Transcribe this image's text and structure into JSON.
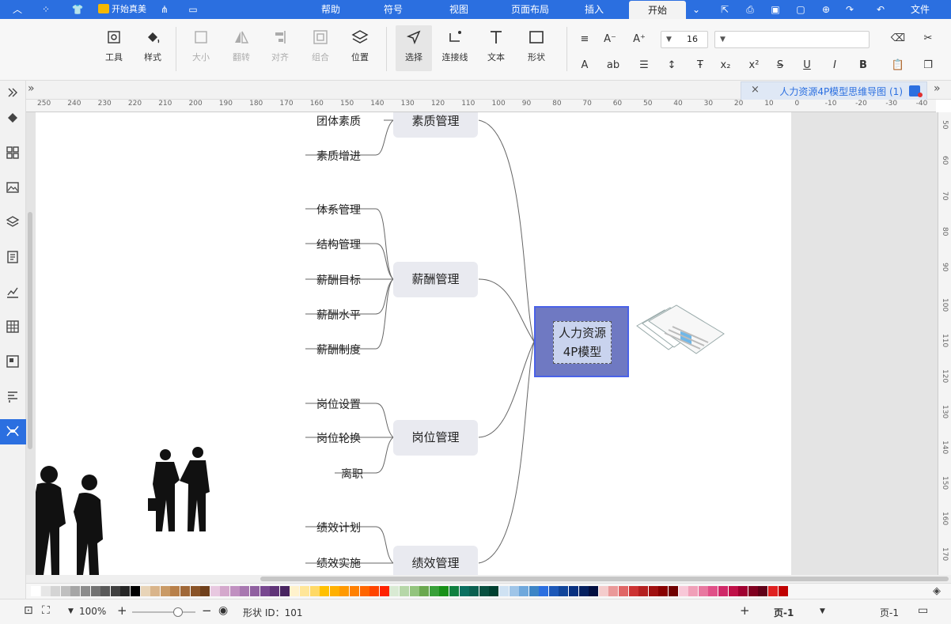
{
  "menu": {
    "tabs": [
      {
        "label": "文件"
      },
      {
        "label": "开始",
        "active": true
      },
      {
        "label": "插入"
      },
      {
        "label": "页面布局"
      },
      {
        "label": "视图"
      },
      {
        "label": "符号"
      },
      {
        "label": "帮助"
      }
    ],
    "brand_label": "开始真美",
    "accent": "#2b6fe0"
  },
  "ribbon": {
    "font_size_value": "16",
    "font_name_value": "",
    "buttons": [
      {
        "key": "tool",
        "label": "工具",
        "icon": "tool-icon"
      },
      {
        "key": "style",
        "label": "样式",
        "icon": "paint-bucket-icon"
      },
      {
        "key": "size",
        "label": "大小",
        "icon": "resize-icon",
        "disabled": true
      },
      {
        "key": "rotate",
        "label": "翻转",
        "icon": "flip-icon",
        "disabled": true
      },
      {
        "key": "align",
        "label": "对齐",
        "icon": "align-icon",
        "disabled": true
      },
      {
        "key": "group",
        "label": "组合",
        "icon": "group-icon",
        "disabled": true
      },
      {
        "key": "position",
        "label": "位置",
        "icon": "layers-icon"
      },
      {
        "key": "select",
        "label": "选择",
        "icon": "cursor-icon",
        "selected": true
      },
      {
        "key": "connector",
        "label": "连接线",
        "icon": "connector-icon"
      },
      {
        "key": "text",
        "label": "文本",
        "icon": "text-icon"
      },
      {
        "key": "shape",
        "label": "形状",
        "icon": "rectangle-icon"
      }
    ]
  },
  "document": {
    "tab_name": "人力资源4P模型思维导图 (1)"
  },
  "rulers": {
    "h_ticks": [
      "250",
      "240",
      "230",
      "220",
      "210",
      "200",
      "190",
      "180",
      "170",
      "160",
      "150",
      "140",
      "130",
      "120",
      "110",
      "100",
      "90",
      "80",
      "70",
      "60",
      "50",
      "40",
      "30",
      "20",
      "10",
      "0",
      "-10",
      "-20",
      "-30",
      "-40",
      "-50"
    ],
    "v_ticks": [
      "50",
      "60",
      "70",
      "80",
      "90",
      "100",
      "110",
      "120",
      "130",
      "140",
      "150",
      "160",
      "170"
    ]
  },
  "mindmap": {
    "center": {
      "line1": "人力资源",
      "line2": "4P模型"
    },
    "branches": [
      {
        "label": "素质管理",
        "leaves": [
          "团体素质",
          "素质增进"
        ]
      },
      {
        "label": "薪酬管理",
        "leaves": [
          "体系管理",
          "结构管理",
          "薪酬目标",
          "薪酬水平",
          "薪酬制度"
        ]
      },
      {
        "label": "岗位管理",
        "leaves": [
          "岗位设置",
          "岗位轮换",
          "离职"
        ]
      },
      {
        "label": "绩效管理",
        "leaves": [
          "绩效计划",
          "绩效实施"
        ]
      }
    ]
  },
  "palette": {
    "colors": [
      "#ffffff",
      "#e6e6e6",
      "#d4d4d4",
      "#bfbfbf",
      "#a6a6a6",
      "#8c8c8c",
      "#737373",
      "#595959",
      "#404040",
      "#262626",
      "#000000",
      "#e8d4b8",
      "#d9b48a",
      "#c99a66",
      "#b8804a",
      "#a06838",
      "#8a5428",
      "#70401c",
      "#e8c8e0",
      "#d4a8cc",
      "#c090c0",
      "#a878b0",
      "#9060a0",
      "#784890",
      "#603478",
      "#482460",
      "#fff2cc",
      "#ffe699",
      "#ffd966",
      "#ffc000",
      "#ffb000",
      "#ff9900",
      "#ff8000",
      "#ff6600",
      "#ff4400",
      "#ff2200",
      "#d9ead3",
      "#b6d7a8",
      "#93c47d",
      "#6aa84f",
      "#38a038",
      "#189018",
      "#108040",
      "#0a7060",
      "#0a6050",
      "#085040",
      "#004030",
      "#cfe2f3",
      "#9fc5e8",
      "#6fa8dc",
      "#3d85c6",
      "#2b6fe0",
      "#1c58b8",
      "#10449a",
      "#083080",
      "#052060",
      "#020f40",
      "#f4cccc",
      "#ea9999",
      "#e06666",
      "#cc3333",
      "#b42020",
      "#a01010",
      "#880000",
      "#700000",
      "#f8c8d8",
      "#f0a0b8",
      "#e878a0",
      "#e05088",
      "#d02868",
      "#c01048",
      "#a00030",
      "#800020",
      "#600018",
      "#e02020",
      "#c00000"
    ]
  },
  "status": {
    "page_label": "页-1",
    "page_tab": "页-1",
    "shape_id_label": "形状 ID：101",
    "zoom_label": "100%"
  }
}
